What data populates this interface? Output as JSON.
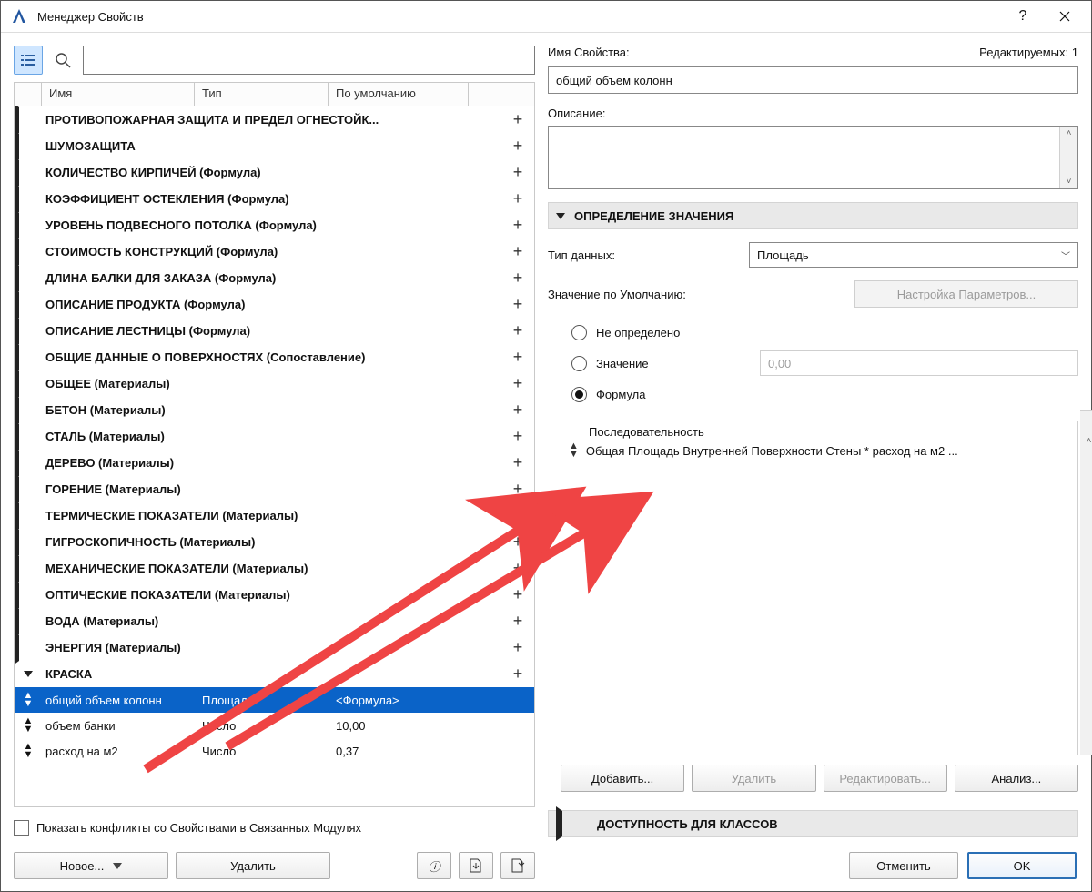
{
  "titlebar": {
    "title": "Менеджер Свойств"
  },
  "leftHeaders": {
    "name": "Имя",
    "type": "Тип",
    "def": "По умолчанию"
  },
  "groups": [
    {
      "label": "ПРОТИВОПОЖАРНАЯ ЗАЩИТА И ПРЕДЕЛ ОГНЕСТОЙК...",
      "expanded": false
    },
    {
      "label": "ШУМОЗАЩИТА",
      "expanded": false
    },
    {
      "label": "КОЛИЧЕСТВО КИРПИЧЕЙ (Формула)",
      "expanded": false
    },
    {
      "label": "КОЭФФИЦИЕНТ ОСТЕКЛЕНИЯ (Формула)",
      "expanded": false
    },
    {
      "label": "УРОВЕНЬ ПОДВЕСНОГО ПОТОЛКА (Формула)",
      "expanded": false
    },
    {
      "label": "СТОИМОСТЬ КОНСТРУКЦИЙ (Формула)",
      "expanded": false
    },
    {
      "label": "ДЛИНА БАЛКИ ДЛЯ ЗАКАЗА (Формула)",
      "expanded": false
    },
    {
      "label": "ОПИСАНИЕ ПРОДУКТА (Формула)",
      "expanded": false
    },
    {
      "label": "ОПИСАНИЕ ЛЕСТНИЦЫ (Формула)",
      "expanded": false
    },
    {
      "label": "ОБЩИЕ ДАННЫЕ О ПОВЕРХНОСТЯХ (Сопоставление)",
      "expanded": false
    },
    {
      "label": "ОБЩЕЕ (Материалы)",
      "expanded": false
    },
    {
      "label": "БЕТОН (Материалы)",
      "expanded": false
    },
    {
      "label": "СТАЛЬ (Материалы)",
      "expanded": false
    },
    {
      "label": "ДЕРЕВО (Материалы)",
      "expanded": false
    },
    {
      "label": "ГОРЕНИЕ (Материалы)",
      "expanded": false
    },
    {
      "label": "ТЕРМИЧЕСКИЕ ПОКАЗАТЕЛИ (Материалы)",
      "expanded": false
    },
    {
      "label": "ГИГРОСКОПИЧНОСТЬ (Материалы)",
      "expanded": false
    },
    {
      "label": "МЕХАНИЧЕСКИЕ ПОКАЗАТЕЛИ (Материалы)",
      "expanded": false
    },
    {
      "label": "ОПТИЧЕСКИЕ ПОКАЗАТЕЛИ (Материалы)",
      "expanded": false
    },
    {
      "label": "ВОДА (Материалы)",
      "expanded": false
    },
    {
      "label": "ЭНЕРГИЯ (Материалы)",
      "expanded": false
    },
    {
      "label": "КРАСКА",
      "expanded": true
    }
  ],
  "leaves": [
    {
      "name": "общий объем колонн",
      "type": "Площадь",
      "def": "<Формула>",
      "selected": true
    },
    {
      "name": "объем банки",
      "type": "Число",
      "def": "10,00",
      "selected": false
    },
    {
      "name": "расход на м2",
      "type": "Число",
      "def": "0,37",
      "selected": false
    }
  ],
  "leftBottom": {
    "conflicts": "Показать конфликты со Свойствами в Связанных Модулях",
    "new": "Новое...",
    "delete": "Удалить"
  },
  "right": {
    "editing": "Редактируемых: 1",
    "nameLabel": "Имя Свойства:",
    "nameValue": "общий объем колонн",
    "descLabel": "Описание:",
    "section1": "ОПРЕДЕЛЕНИЕ ЗНАЧЕНИЯ",
    "dtypeLabel": "Тип данных:",
    "dtypeValue": "Площадь",
    "defaultLabel": "Значение по Умолчанию:",
    "paramBtn": "Настройка Параметров...",
    "radios": {
      "undef": "Не определено",
      "value": "Значение",
      "formula": "Формула"
    },
    "valuePlaceholder": "0,00",
    "seq": "Последовательность",
    "formula": "Общая Площадь Внутренней Поверхности Стены * расход на м2 ...",
    "addBtn": "Добавить...",
    "delBtn": "Удалить",
    "editBtn": "Редактировать...",
    "analBtn": "Анализ...",
    "section2": "ДОСТУПНОСТЬ ДЛЯ КЛАССОВ",
    "cancel": "Отменить",
    "ok": "OK"
  }
}
